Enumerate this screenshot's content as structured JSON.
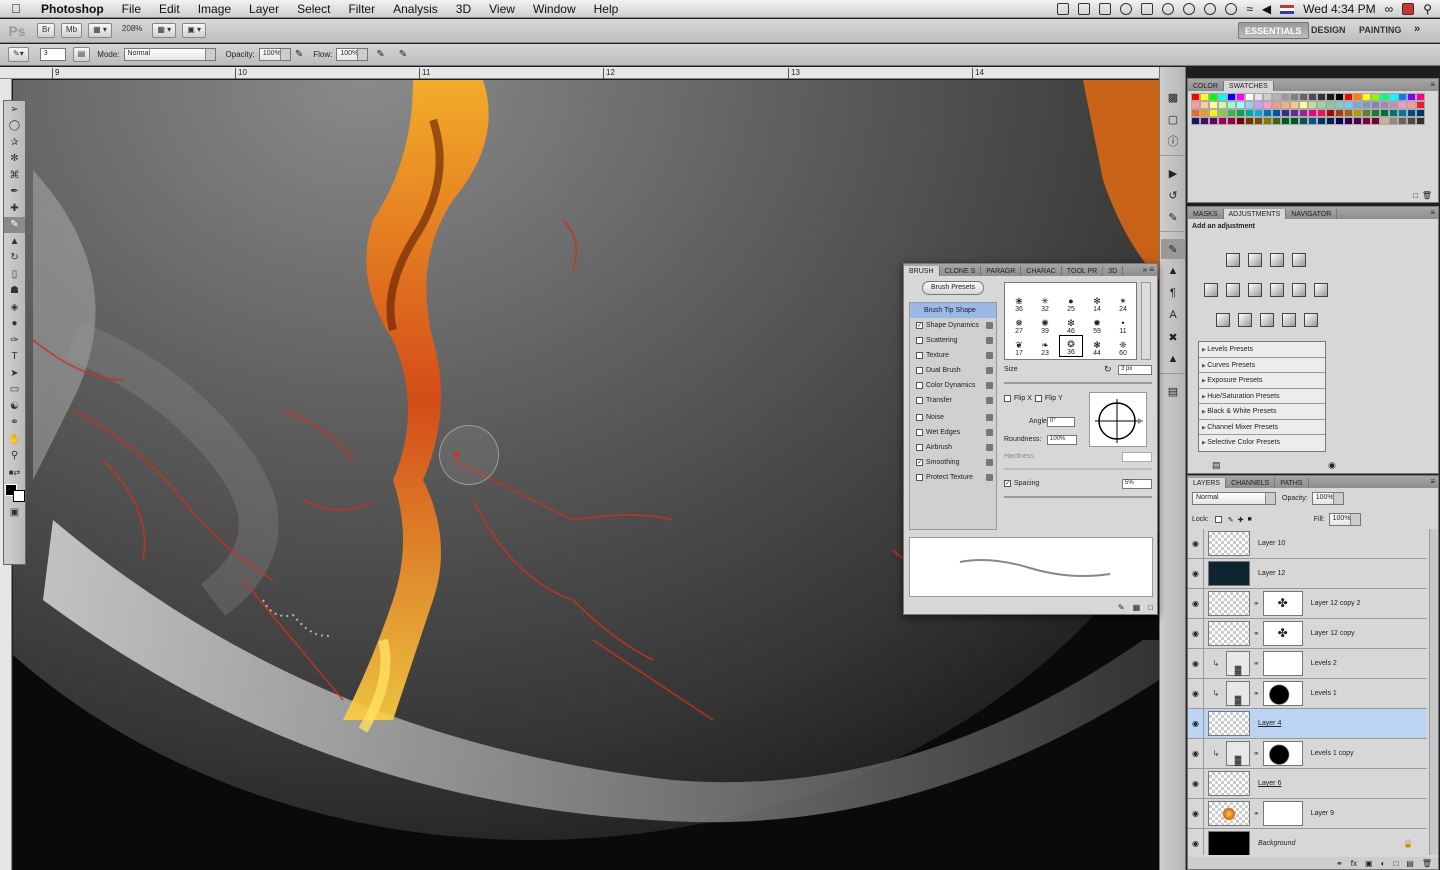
{
  "menubar": {
    "app_name": "Photoshop",
    "items": [
      "File",
      "Edit",
      "Image",
      "Layer",
      "Select",
      "Filter",
      "Analysis",
      "3D",
      "View",
      "Window",
      "Help"
    ],
    "clock": "Wed 4:34 PM"
  },
  "appbar": {
    "logo": "Ps",
    "br_label": "Br",
    "mb_label": "Mb",
    "zoom": "208%",
    "workspaces": [
      "ESSENTIALS",
      "DESIGN",
      "PAINTING"
    ],
    "more": "»"
  },
  "options": {
    "brush_size": "3",
    "mode_label": "Mode:",
    "mode_value": "Normal",
    "opacity_label": "Opacity:",
    "opacity_value": "100%",
    "flow_label": "Flow:",
    "flow_value": "100%"
  },
  "ruler": {
    "ticks": [
      "9",
      "10",
      "11",
      "12",
      "13",
      "14"
    ]
  },
  "swatches_panel": {
    "tabs": [
      "COLOR",
      "SWATCHES"
    ],
    "colors": [
      "#ff0000",
      "#ffff00",
      "#00ff00",
      "#00ffff",
      "#0000ff",
      "#ff00ff",
      "#ffffff",
      "#e6e6e6",
      "#cccccc",
      "#b3b3b3",
      "#999999",
      "#808080",
      "#666666",
      "#4d4d4d",
      "#333333",
      "#1a1a1a",
      "#000000",
      "#ff0000",
      "#ff8000",
      "#ffff00",
      "#80ff00",
      "#00ff80",
      "#00ffff",
      "#0080ff",
      "#8000ff",
      "#ff0080",
      "#ff9999",
      "#ffcc99",
      "#ffff99",
      "#ccff99",
      "#99ffcc",
      "#99ffff",
      "#99ccff",
      "#cc99ff",
      "#ff99cc",
      "#f7977a",
      "#f9ad81",
      "#fdc68a",
      "#fff79a",
      "#c4df9b",
      "#a2d39c",
      "#82ca9d",
      "#7bcdc8",
      "#6ecff6",
      "#7ea7d8",
      "#8493ca",
      "#8882be",
      "#a187be",
      "#bc8dbf",
      "#f49ac2",
      "#f6989d",
      "#ed1c24",
      "#f26522",
      "#f7941d",
      "#fff200",
      "#8dc63f",
      "#39b54a",
      "#00a651",
      "#00a99d",
      "#00aeef",
      "#0072bc",
      "#0054a6",
      "#2e3192",
      "#662d91",
      "#92278f",
      "#ec008c",
      "#ed145b",
      "#9e0b0f",
      "#a0410d",
      "#a36209",
      "#aba000",
      "#598527",
      "#1a7b30",
      "#007236",
      "#00746b",
      "#0076a3",
      "#004b80",
      "#003471",
      "#1b1464",
      "#440e62",
      "#630460",
      "#9e005d",
      "#9e0039",
      "#790000",
      "#7b2e00",
      "#7d4900",
      "#827b00",
      "#406618",
      "#005e20",
      "#005826",
      "#005952",
      "#005b7f",
      "#003663",
      "#002157",
      "#0d004c",
      "#32004b",
      "#4b0049",
      "#7b0046",
      "#7a0026",
      "#c7b299",
      "#998675",
      "#736357",
      "#534741",
      "#362f2d"
    ]
  },
  "adjustments_panel": {
    "tabs": [
      "MASKS",
      "ADJUSTMENTS",
      "NAVIGATOR"
    ],
    "title": "Add an adjustment",
    "presets": [
      "Levels Presets",
      "Curves Presets",
      "Exposure Presets",
      "Hue/Saturation Presets",
      "Black & White Presets",
      "Channel Mixer Presets",
      "Selective Color Presets"
    ]
  },
  "layers_panel": {
    "tabs": [
      "LAYERS",
      "CHANNELS",
      "PATHS"
    ],
    "blend_mode": "Normal",
    "opacity_label": "Opacity:",
    "opacity_value": "100%",
    "lock_label": "Lock:",
    "fill_label": "Fill:",
    "fill_value": "100%",
    "layers": [
      {
        "name": "Layer 10"
      },
      {
        "name": "Layer 12"
      },
      {
        "name": "Layer 12 copy 2"
      },
      {
        "name": "Layer 12 copy"
      },
      {
        "name": "Levels 2"
      },
      {
        "name": "Levels 1"
      },
      {
        "name": "Layer 4"
      },
      {
        "name": "Levels 1 copy"
      },
      {
        "name": "Layer 6"
      },
      {
        "name": "Layer 9"
      },
      {
        "name": "Background"
      }
    ]
  },
  "brush_panel": {
    "tabs": [
      "BRUSH",
      "CLONE S",
      "PARAGR",
      "CHARAC",
      "TOOL PR",
      "3D"
    ],
    "presets_button": "Brush Presets",
    "options": [
      "Brush Tip Shape",
      "Shape Dynamics",
      "Scattering",
      "Texture",
      "Dual Brush",
      "Color Dynamics",
      "Transfer",
      "Noise",
      "Wet Edges",
      "Airbrush",
      "Smoothing",
      "Protect Texture"
    ],
    "checked": [
      false,
      true,
      false,
      false,
      false,
      false,
      false,
      false,
      false,
      false,
      true,
      false
    ],
    "tip_sizes": [
      "36",
      "32",
      "25",
      "14",
      "24",
      "27",
      "39",
      "46",
      "59",
      "11",
      "17",
      "23",
      "36",
      "44",
      "60"
    ],
    "size_label": "Size",
    "size_value": "3 px",
    "flipx_label": "Flip X",
    "flipy_label": "Flip Y",
    "angle_label": "Angle:",
    "angle_value": "0°",
    "roundness_label": "Roundness:",
    "roundness_value": "100%",
    "hardness_label": "Hardness",
    "spacing_label": "Spacing",
    "spacing_value": "5%"
  }
}
